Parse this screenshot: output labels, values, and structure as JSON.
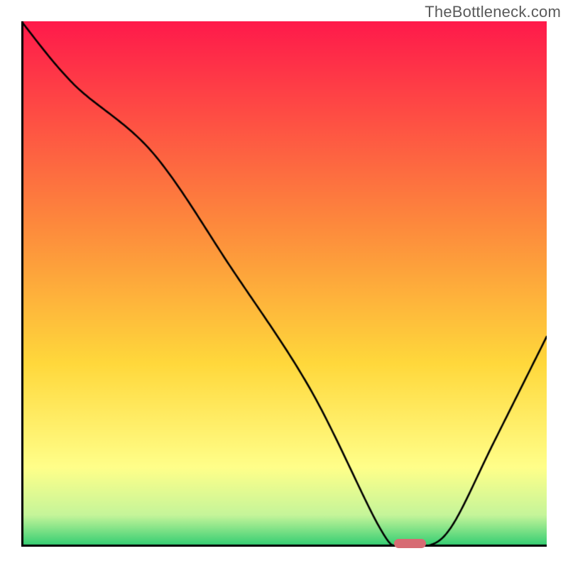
{
  "watermark": "TheBottleneck.com",
  "colors": {
    "curve": "#000000",
    "axis": "#000000",
    "gradient_top": "#ff1a4b",
    "gradient_upper_mid": "#fd8d3c",
    "gradient_mid": "#ffd83b",
    "gradient_lower_mid": "#ffff8a",
    "gradient_near_bottom": "#c5f59a",
    "gradient_bottom": "#2ecc71",
    "marker": "#d76b73"
  },
  "chart_data": {
    "type": "line",
    "title": "",
    "xlabel": "",
    "ylabel": "",
    "xlim": [
      0,
      100
    ],
    "ylim": [
      0,
      100
    ],
    "x": [
      0,
      10,
      25,
      40,
      55,
      68,
      72,
      77,
      82,
      90,
      100
    ],
    "y": [
      100,
      88,
      75,
      53,
      30,
      4,
      0,
      0,
      4,
      20,
      40
    ],
    "optimal_x": 74,
    "optimal_width": 6,
    "gradient_stops": [
      {
        "pos": 0.0,
        "color_key": "gradient_top"
      },
      {
        "pos": 0.4,
        "color_key": "gradient_upper_mid"
      },
      {
        "pos": 0.65,
        "color_key": "gradient_mid"
      },
      {
        "pos": 0.85,
        "color_key": "gradient_lower_mid"
      },
      {
        "pos": 0.94,
        "color_key": "gradient_near_bottom"
      },
      {
        "pos": 1.0,
        "color_key": "gradient_bottom"
      }
    ]
  }
}
